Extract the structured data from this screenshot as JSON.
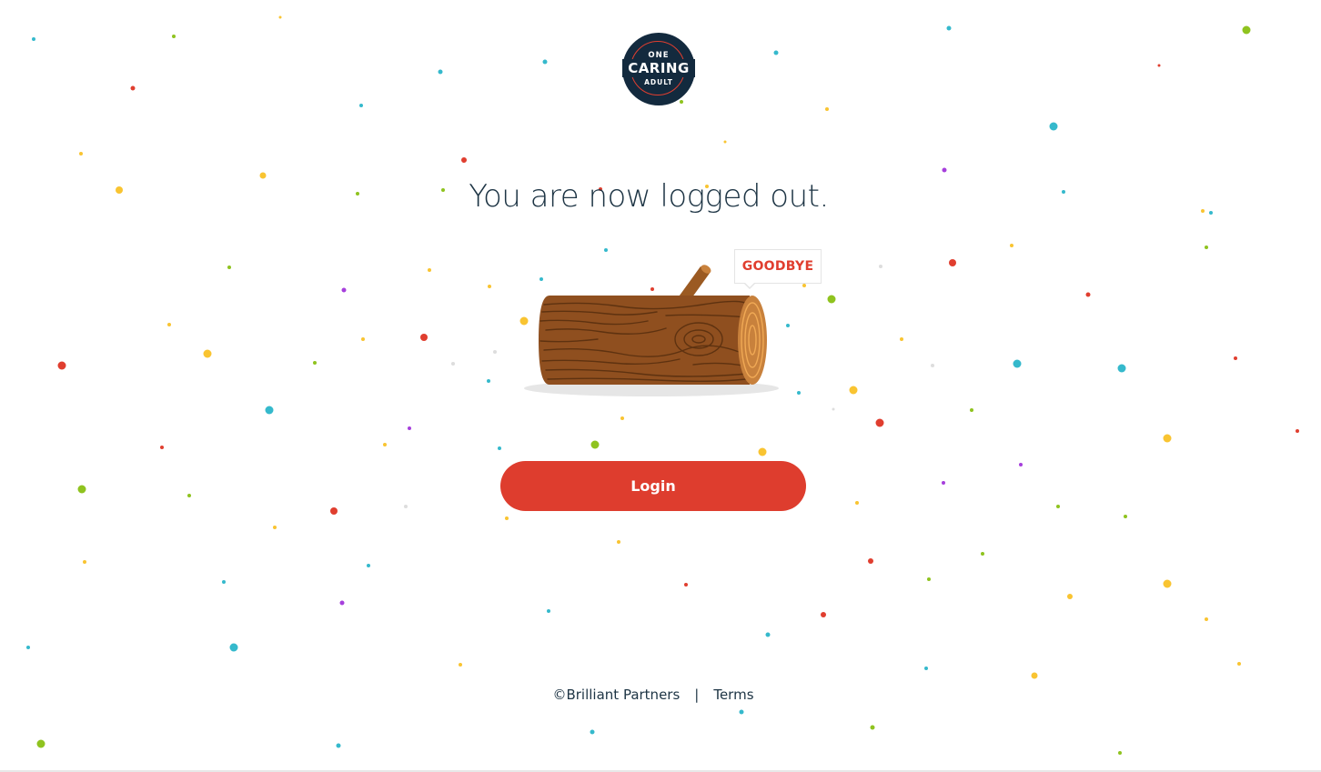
{
  "logo": {
    "top": "ONE",
    "middle": "CARING",
    "bottom": "ADULT"
  },
  "headline": "You are now logged out.",
  "illustration": {
    "bubble_text": "GOODBYE"
  },
  "login_button_label": "Login",
  "footer": {
    "copyright": "©Brilliant Partners",
    "separator": "|",
    "terms_label": "Terms"
  },
  "colors": {
    "navy": "#132a3e",
    "accent_red": "#de3d2e",
    "text": "#1d3444",
    "confetti": [
      "#e03e2f",
      "#35b9cc",
      "#f9c431",
      "#8fc31f",
      "#a63fdc",
      "#e89a2b",
      "#dddddd"
    ]
  }
}
